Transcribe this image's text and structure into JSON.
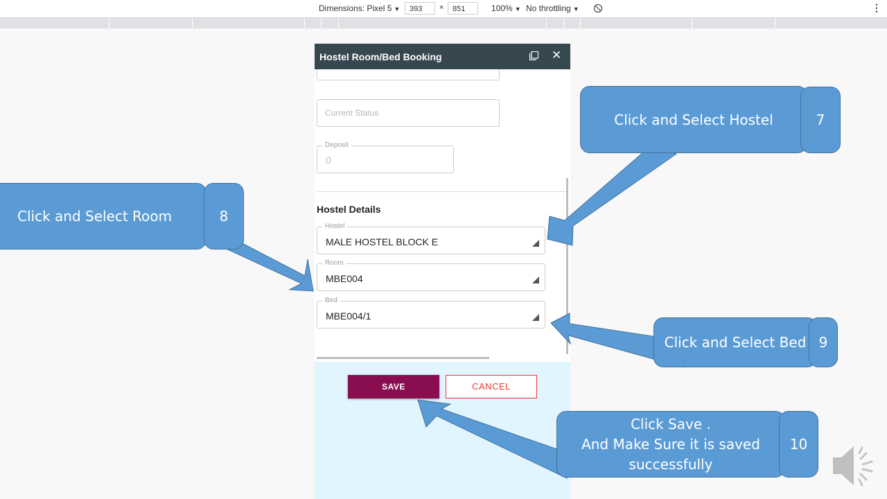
{
  "devtools": {
    "dimensions_label": "Dimensions: Pixel 5",
    "width": "393",
    "times": "×",
    "height": "851",
    "zoom": "100%",
    "throttling": "No throttling",
    "caret": "▼",
    "more": "⋮"
  },
  "dialog": {
    "title": "Hostel Room/Bed Booking",
    "close": "✕",
    "current_status_placeholder": "Current Status",
    "deposit_label": "Deposit",
    "deposit_value": "0",
    "section_title": "Hostel Details",
    "hostel_label": "Hostel",
    "hostel_value": "MALE HOSTEL BLOCK E",
    "room_label": "Room",
    "room_value": "MBE004",
    "bed_label": "Bed",
    "bed_value": "MBE004/1",
    "save_label": "SAVE",
    "cancel_label": "CANCEL"
  },
  "callouts": {
    "hostel": {
      "text": "Click and Select Hostel",
      "step": "7"
    },
    "room": {
      "text": "Click and Select Room",
      "step": "8"
    },
    "bed": {
      "text": "Click and Select Bed",
      "step": "9"
    },
    "save": {
      "line1": "Click  Save .",
      "line2": "And Make Sure it is saved",
      "line3": "successfully",
      "step": "10"
    }
  },
  "colors": {
    "dialog_header": "#37474f",
    "save_button": "#880e4f",
    "cancel_button": "#e53935",
    "footer_bg": "#e1f5fe",
    "callout_fill": "#5b9bd5",
    "callout_border": "#41719c"
  }
}
